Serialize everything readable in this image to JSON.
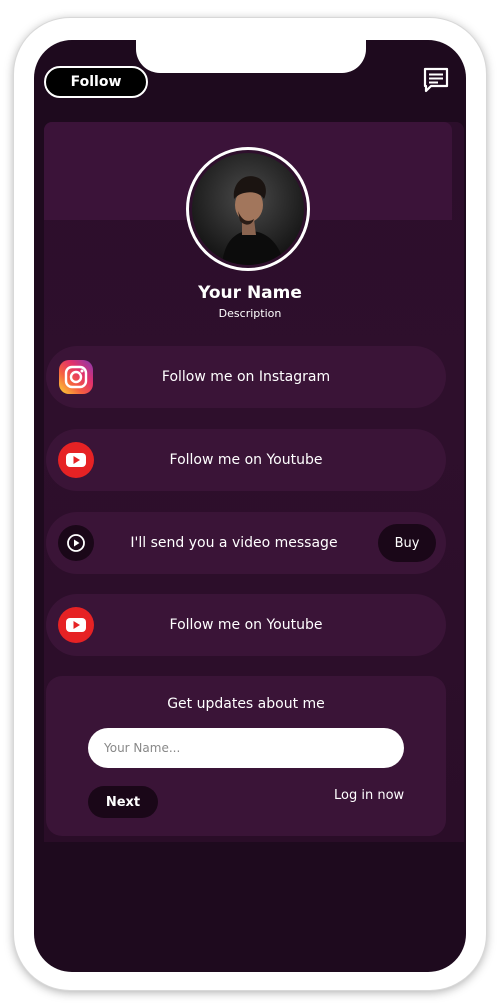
{
  "header": {
    "follow_label": "Follow",
    "chat_icon": "chat-icon"
  },
  "profile": {
    "name": "Your Name",
    "description": "Description",
    "avatar_icon": "avatar-photo"
  },
  "links": [
    {
      "label": "Follow me on Instagram",
      "icon": "instagram-icon"
    },
    {
      "label": "Follow me on Youtube",
      "icon": "youtube-icon"
    },
    {
      "label": "I'll send you a video message",
      "icon": "play-icon",
      "action_label": "Buy"
    },
    {
      "label": "Follow me on Youtube",
      "icon": "youtube-icon"
    }
  ],
  "updates": {
    "title": "Get updates about me",
    "input_placeholder": "Your Name...",
    "next_label": "Next",
    "login_label": "Log in now"
  },
  "colors": {
    "background": "#1e0a1e",
    "card": "#3a1437",
    "youtube_red": "#e62224",
    "button_dark": "#1a0718"
  }
}
